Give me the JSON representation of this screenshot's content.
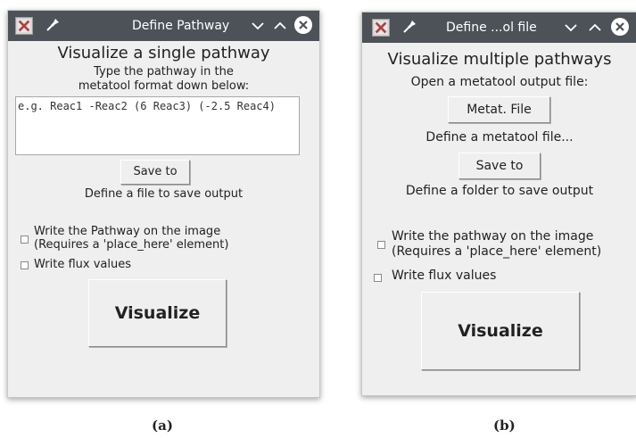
{
  "window_a": {
    "title": "Define Pathway",
    "heading": "Visualize a single pathway",
    "instruction_line1": "Type the pathway in the",
    "instruction_line2": "metatool format down below:",
    "pathway_input_placeholder": "e.g. Reac1 -Reac2 (6 Reac3) (-2.5 Reac4)",
    "save_button": "Save to",
    "save_hint": "Define a file to save output",
    "checkbox_write_pathway_line1": "Write the Pathway on the image",
    "checkbox_write_pathway_line2": "(Requires a 'place_here' element)",
    "checkbox_write_flux": "Write flux values",
    "visualize_button": "Visualize"
  },
  "window_b": {
    "title": "Define ...ol file",
    "heading": "Visualize multiple pathways",
    "open_hint": "Open a metatool output file:",
    "metat_file_button": "Metat. File",
    "metat_file_hint": "Define a metatool file...",
    "save_button": "Save to",
    "save_hint": "Define a folder to save output",
    "checkbox_write_pathway_line1": "Write the pathway on the image",
    "checkbox_write_pathway_line2": "(Requires a 'place_here' element)",
    "checkbox_write_flux": "Write flux values",
    "visualize_button": "Visualize"
  },
  "captions": {
    "a": "(a)",
    "b": "(b)"
  },
  "icons": {
    "app": "app-icon",
    "pin": "pin-icon",
    "minimize": "chevron-down-icon",
    "maximize": "chevron-up-icon",
    "close": "close-icon"
  },
  "colors": {
    "titlebar": "#4d5258",
    "window_bg": "#efefef",
    "close_button": "#ffffff"
  }
}
